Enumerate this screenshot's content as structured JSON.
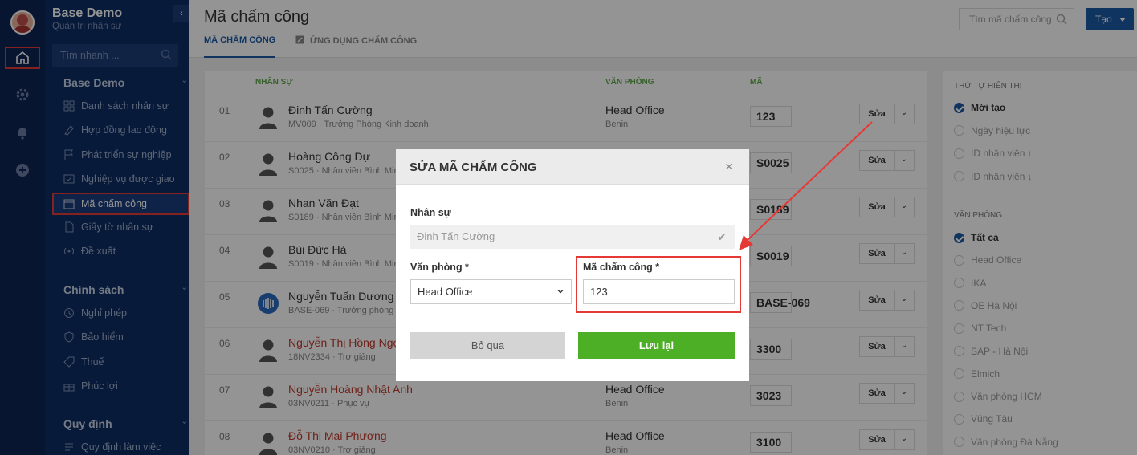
{
  "sidebar": {
    "org_name": "Base Demo",
    "org_sub": "Quản trị nhân sự",
    "search_placeholder": "Tìm nhanh ...",
    "groups": [
      {
        "label": "Base Demo"
      },
      {
        "label": "Chính sách"
      },
      {
        "label": "Quy định"
      }
    ],
    "items": [
      {
        "label": "Danh sách nhân sự",
        "icon": "grid-icon"
      },
      {
        "label": "Hợp đồng lao động",
        "icon": "contract-icon"
      },
      {
        "label": "Phát triển sự nghiệp",
        "icon": "flag-icon"
      },
      {
        "label": "Nghiệp vụ được giao",
        "icon": "task-icon"
      },
      {
        "label": "Mã chấm công",
        "icon": "calendar-icon"
      },
      {
        "label": "Giấy tờ nhân sự",
        "icon": "document-icon"
      },
      {
        "label": "Đề xuất",
        "icon": "broadcast-icon"
      },
      {
        "label": "Nghỉ phép",
        "icon": "clock-icon"
      },
      {
        "label": "Bảo hiểm",
        "icon": "shield-icon"
      },
      {
        "label": "Thuế",
        "icon": "tag-icon"
      },
      {
        "label": "Phúc lợi",
        "icon": "gift-icon"
      },
      {
        "label": "Quy định làm việc",
        "icon": "rule-icon"
      }
    ]
  },
  "header": {
    "title": "Mã chấm công",
    "tabs": [
      {
        "label": "MÃ CHẤM CÔNG"
      },
      {
        "label": "ỨNG DỤNG CHẤM CÔNG"
      }
    ],
    "search_placeholder": "Tìm mã chấm công",
    "create_label": "Tạo"
  },
  "table": {
    "headers": {
      "staff": "NHÂN SỰ",
      "office": "VĂN PHÒNG",
      "code": "MÃ"
    },
    "edit_label": "Sửa",
    "rows": [
      {
        "idx": "01",
        "name": "Đinh Tấn Cường",
        "sub": "MV009 · Trưởng Phòng Kinh doanh",
        "office": "Head Office",
        "office_sub": "Benin",
        "code": "123"
      },
      {
        "idx": "02",
        "name": "Hoàng Công Dự",
        "sub": "S0025 · Nhân viên Bình Minh",
        "office": "",
        "office_sub": "",
        "code": "S0025"
      },
      {
        "idx": "03",
        "name": "Nhan Văn Đạt",
        "sub": "S0189 · Nhân viên Bình Minh",
        "office": "",
        "office_sub": "",
        "code": "S0189"
      },
      {
        "idx": "04",
        "name": "Bùi Đức Hà",
        "sub": "S0019 · Nhân viên Bình Minh",
        "office": "",
        "office_sub": "",
        "code": "S0019"
      },
      {
        "idx": "05",
        "name": "Nguyễn Tuấn Dương",
        "sub": "BASE-069 · Trưởng phòng kỹ",
        "office": "",
        "office_sub": "",
        "code": "BASE-069"
      },
      {
        "idx": "06",
        "name": "Nguyễn Thị Hồng Ngọc",
        "sub": "18NV2334 · Trợ giảng",
        "office": "",
        "office_sub": "",
        "code": "3300"
      },
      {
        "idx": "07",
        "name": "Nguyễn Hoàng Nhật Anh",
        "sub": "03NV0211 · Phục vụ",
        "office": "Head Office",
        "office_sub": "Benin",
        "code": "3023"
      },
      {
        "idx": "08",
        "name": "Đỗ Thị Mai Phương",
        "sub": "03NV0210 · Trợ giảng",
        "office": "Head Office",
        "office_sub": "Benin",
        "code": "3100"
      }
    ]
  },
  "filter": {
    "order_title": "THỨ TỰ HIỂN THỊ",
    "order_options": [
      {
        "label": "Mới tạo",
        "checked": true
      },
      {
        "label": "Ngày hiệu lực",
        "checked": false
      },
      {
        "label": "ID nhân viên ↑",
        "checked": false
      },
      {
        "label": "ID nhân viên ↓",
        "checked": false
      }
    ],
    "office_title": "VĂN PHÒNG",
    "office_options": [
      {
        "label": "Tất cả",
        "checked": true
      },
      {
        "label": "Head Office",
        "checked": false
      },
      {
        "label": "IKA",
        "checked": false
      },
      {
        "label": "OE Hà Nội",
        "checked": false
      },
      {
        "label": "NT Tech",
        "checked": false
      },
      {
        "label": "SAP - Hà Nội",
        "checked": false
      },
      {
        "label": "Elmich",
        "checked": false
      },
      {
        "label": "Văn phòng HCM",
        "checked": false
      },
      {
        "label": "Vũng Tàu",
        "checked": false
      },
      {
        "label": "Văn phòng Đà Nẵng",
        "checked": false
      }
    ]
  },
  "modal": {
    "title": "SỬA MÃ CHẤM CÔNG",
    "staff_label": "Nhân sự",
    "staff_value": "Đinh Tấn Cường",
    "office_label": "Văn phòng *",
    "office_value": "Head Office",
    "code_label": "Mã chấm công *",
    "code_value": "123",
    "cancel_label": "Bỏ qua",
    "save_label": "Lưu lại"
  },
  "colors": {
    "sidebar_bg": "#0f2d63",
    "accent": "#1a5aa5",
    "save_green": "#4caf25",
    "annotation_red": "#e53935"
  }
}
